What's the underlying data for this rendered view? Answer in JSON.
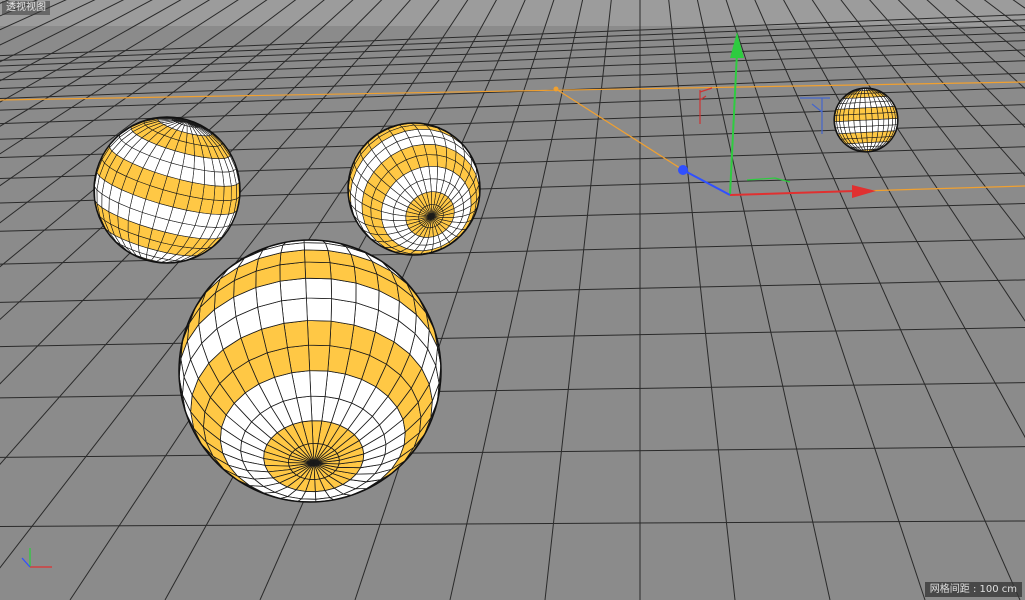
{
  "viewport": {
    "title": "透视视图",
    "grid_spacing": "网格间距 : 100 cm"
  },
  "colors": {
    "background_sky": "#9b9b9b",
    "floor": "#8b8b8b",
    "grid_line": "#2a2a2a",
    "sphere_stripe": "#ffc845",
    "sphere_base": "#ffffff",
    "sphere_wire": "#1a1a1a",
    "axis_x": "#e03030",
    "axis_y": "#2ecc40",
    "axis_z": "#3050ff",
    "selection_line": "#f0a030"
  },
  "icons": {
    "world_axis": "xyz-axis-icon",
    "move_gizmo": "move-gizmo-icon"
  }
}
